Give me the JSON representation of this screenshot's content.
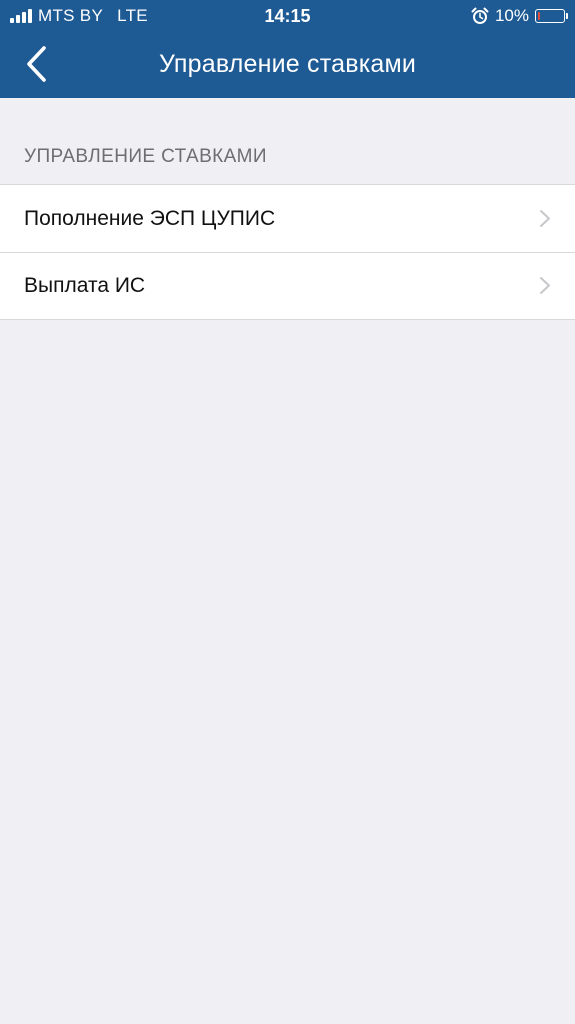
{
  "status_bar": {
    "carrier": "MTS BY",
    "network": "LTE",
    "time": "14:15",
    "battery_percent_label": "10%",
    "battery_level": 0.1,
    "battery_color": "#e8473e",
    "icons": [
      "signal-icon",
      "alarm-icon",
      "battery-icon"
    ]
  },
  "nav": {
    "title": "Управление ставками",
    "back_icon": "chevron-left-icon",
    "bar_color": "#1e5a94"
  },
  "section": {
    "header": "УПРАВЛЕНИЕ СТАВКАМИ",
    "items": [
      {
        "label": "Пополнение ЭСП ЦУПИС",
        "icon": "chevron-right-icon"
      },
      {
        "label": "Выплата ИС",
        "icon": "chevron-right-icon"
      }
    ]
  },
  "colors": {
    "background": "#efeff4",
    "cell_background": "#ffffff",
    "separator": "#d8d8dc",
    "section_header_text": "#6d6d72",
    "chevron": "#c7c7cc"
  }
}
